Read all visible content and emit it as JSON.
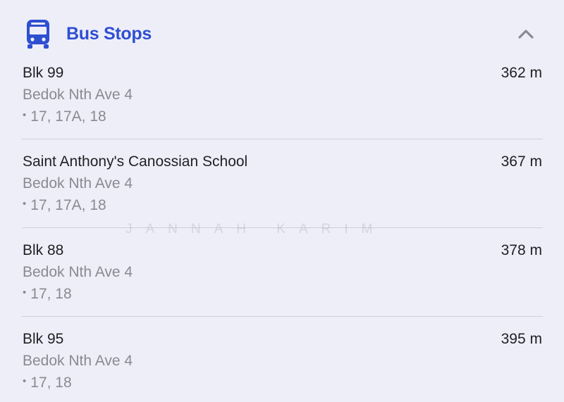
{
  "section": {
    "title": "Bus Stops",
    "icon": "bus-icon",
    "collapse_icon": "chevron-up-icon",
    "accent_color": "#2f4fd1"
  },
  "stops": [
    {
      "name": "Blk 99",
      "distance": "362 m",
      "road": "Bedok Nth Ave 4",
      "services": "17, 17A, 18"
    },
    {
      "name": "Saint Anthony's Canossian School",
      "distance": "367 m",
      "road": "Bedok Nth Ave 4",
      "services": "17, 17A, 18"
    },
    {
      "name": "Blk 88",
      "distance": "378 m",
      "road": "Bedok Nth Ave 4",
      "services": "17, 18"
    },
    {
      "name": "Blk 95",
      "distance": "395 m",
      "road": "Bedok Nth Ave 4",
      "services": "17, 18"
    }
  ],
  "bullet": "•",
  "watermark": "JANNAH KARIM"
}
